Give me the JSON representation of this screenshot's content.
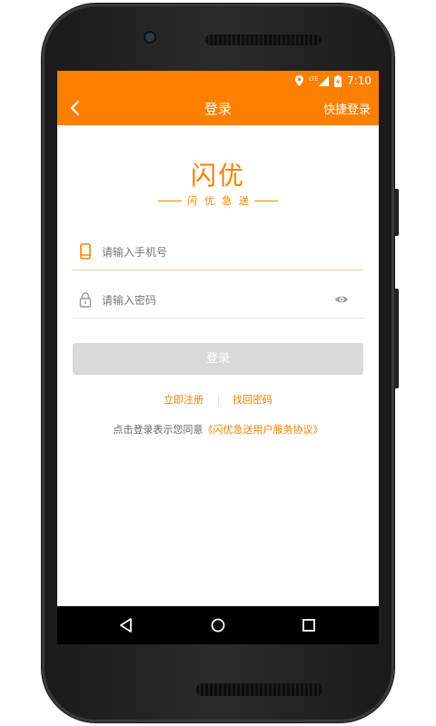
{
  "status_bar": {
    "network": "LTE",
    "time": "7:10"
  },
  "app_bar": {
    "back_icon": "chevron-left-icon",
    "title": "登录",
    "quick_login": "快捷登录"
  },
  "brand": {
    "logo_text": "闪优",
    "slogan": "闪优急送"
  },
  "form": {
    "phone": {
      "icon": "phone-icon",
      "value": "",
      "placeholder": "请输入手机号"
    },
    "password": {
      "icon": "lock-icon",
      "value": "",
      "placeholder": "请输入密码",
      "toggle_icon": "eye-icon"
    },
    "login_button": "登录"
  },
  "links": {
    "register": "立即注册",
    "forgot_password": "找回密码"
  },
  "agreement": {
    "prefix": "点击登录表示您同意",
    "link": "《闪优急送用户服务协议》"
  },
  "nav": {
    "back": "triangle-back-icon",
    "home": "circle-home-icon",
    "recents": "square-recents-icon"
  },
  "colors": {
    "accent": "#ff7f00",
    "button_disabled": "#d9d9d9",
    "nav_bar": "#000000"
  }
}
